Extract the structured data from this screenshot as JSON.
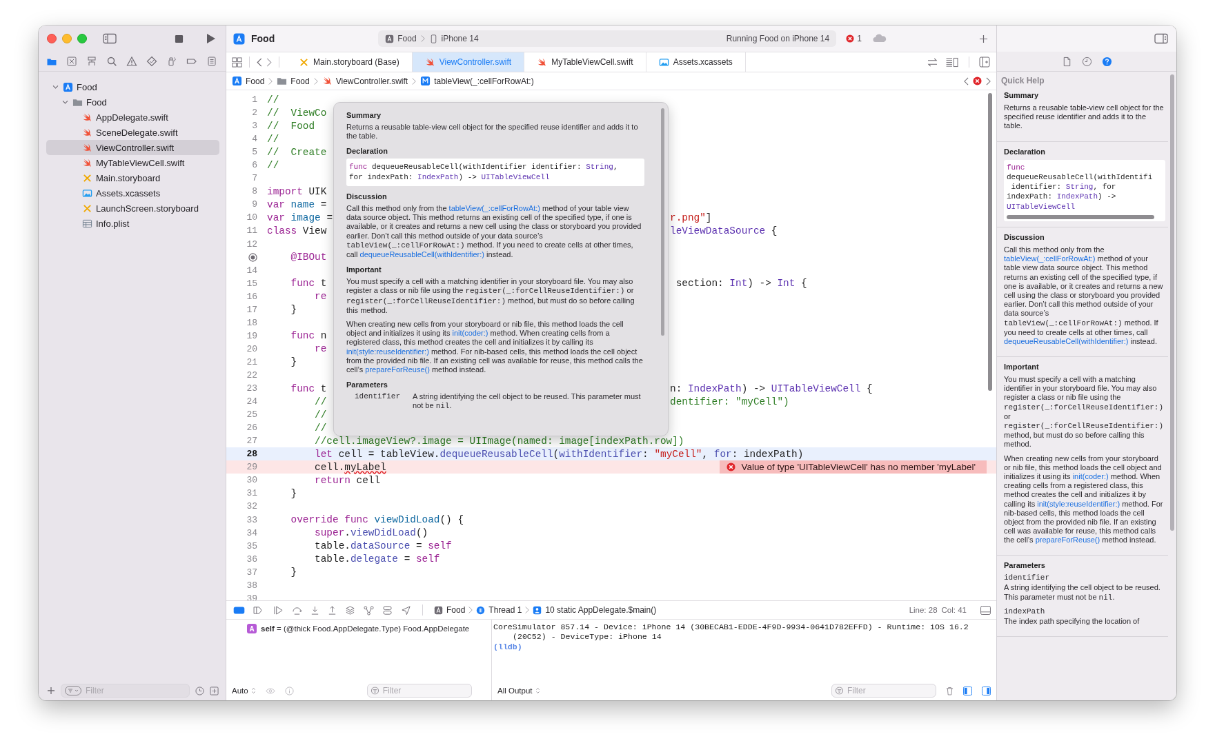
{
  "window": {
    "title": "Food"
  },
  "navigator_tabs": [
    {
      "kind": "folder",
      "selected": true
    },
    {
      "kind": "sourcecontrol",
      "selected": false
    },
    {
      "kind": "hierarchy",
      "selected": false
    },
    {
      "kind": "search",
      "selected": false
    },
    {
      "kind": "warning",
      "selected": false
    },
    {
      "kind": "test",
      "selected": false
    },
    {
      "kind": "debug",
      "selected": false
    },
    {
      "kind": "breakpoint",
      "selected": false
    },
    {
      "kind": "report",
      "selected": false
    }
  ],
  "tree": [
    {
      "label": "Food",
      "kind": "project",
      "expanded": true,
      "selected": false,
      "children": [
        {
          "label": "Food",
          "kind": "folder",
          "expanded": true,
          "selected": false,
          "children": [
            {
              "label": "AppDelegate.swift",
              "kind": "swift",
              "selected": false
            },
            {
              "label": "SceneDelegate.swift",
              "kind": "swift",
              "selected": false
            },
            {
              "label": "ViewController.swift",
              "kind": "swift",
              "selected": true
            },
            {
              "label": "MyTableViewCell.swift",
              "kind": "swift",
              "selected": false
            },
            {
              "label": "Main.storyboard",
              "kind": "storyboard",
              "selected": false
            },
            {
              "label": "Assets.xcassets",
              "kind": "assets",
              "selected": false
            },
            {
              "label": "LaunchScreen.storyboard",
              "kind": "storyboard",
              "selected": false
            },
            {
              "label": "Info.plist",
              "kind": "plist",
              "selected": false
            }
          ]
        }
      ]
    }
  ],
  "navigator_filter": {
    "placeholder": "Filter"
  },
  "activity": {
    "scheme": "Food",
    "device": "iPhone 14",
    "status": "Running Food on iPhone 14",
    "issues": "1"
  },
  "editor_tabs": [
    {
      "label": "Main.storyboard (Base)",
      "kind": "storyboard",
      "selected": false
    },
    {
      "label": "ViewController.swift",
      "kind": "swift",
      "selected": true
    },
    {
      "label": "MyTableViewCell.swift",
      "kind": "swift",
      "selected": false
    },
    {
      "label": "Assets.xcassets",
      "kind": "assets",
      "selected": false
    }
  ],
  "jump_bar": [
    {
      "label": "Food",
      "kind": "project"
    },
    {
      "label": "Food",
      "kind": "folder"
    },
    {
      "label": "ViewController.swift",
      "kind": "swift"
    },
    {
      "label": "tableView(_:cellForRowAt:)",
      "kind": "method"
    }
  ],
  "code_lines": [
    {
      "number": "1",
      "current": false,
      "error": false,
      "tokens": [
        {
          "kind": "cm",
          "text": "//"
        }
      ]
    },
    {
      "number": "2",
      "current": false,
      "error": false,
      "tokens": [
        {
          "kind": "cm",
          "text": "//  ViewCo"
        }
      ]
    },
    {
      "number": "3",
      "current": false,
      "error": false,
      "tokens": [
        {
          "kind": "cm",
          "text": "//  Food"
        }
      ]
    },
    {
      "number": "4",
      "current": false,
      "error": false,
      "tokens": [
        {
          "kind": "cm",
          "text": "//"
        }
      ]
    },
    {
      "number": "5",
      "current": false,
      "error": false,
      "tokens": [
        {
          "kind": "cm",
          "text": "//  Create"
        }
      ]
    },
    {
      "number": "6",
      "current": false,
      "error": false,
      "tokens": [
        {
          "kind": "cm",
          "text": "//"
        }
      ]
    },
    {
      "number": "7",
      "current": false,
      "error": false
    },
    {
      "number": "8",
      "current": false,
      "error": false,
      "tokens": [
        {
          "kind": "kw",
          "text": "import"
        },
        {
          "kind": "pl",
          "text": " UIK"
        }
      ]
    },
    {
      "number": "9",
      "current": false,
      "error": false,
      "tokens": [
        {
          "kind": "kw",
          "text": "var"
        },
        {
          "kind": "dc",
          "text": " name"
        },
        {
          "kind": "pl",
          "text": " ="
        }
      ]
    },
    {
      "number": "10",
      "current": false,
      "error": false,
      "tokens": [
        {
          "kind": "kw",
          "text": "var"
        },
        {
          "kind": "dc",
          "text": " image"
        },
        {
          "kind": "pl",
          "text": " ="
        }
      ],
      "right": [
        {
          "kind": "st",
          "text": "r.png\""
        },
        {
          "kind": "pl",
          "text": "]"
        }
      ]
    },
    {
      "number": "11",
      "current": false,
      "error": false,
      "tokens": [
        {
          "kind": "kw",
          "text": "class"
        },
        {
          "kind": "pl",
          "text": " View"
        }
      ],
      "right": [
        {
          "kind": "ty",
          "text": "leViewDataSource"
        },
        {
          "kind": "pl",
          "text": " {"
        }
      ]
    },
    {
      "number": "12",
      "current": false,
      "error": false
    },
    {
      "outlet_connected": true,
      "current": false,
      "error": false,
      "tokens": [
        {
          "kind": "kw",
          "text": "    @IBOut"
        }
      ]
    },
    {
      "number": "14",
      "current": false,
      "error": false
    },
    {
      "number": "15",
      "current": false,
      "error": false,
      "tokens": [
        {
          "kind": "kw",
          "text": "    func"
        },
        {
          "kind": "pl",
          "text": " t"
        }
      ],
      "right": [
        {
          "kind": "pl",
          "text": " section: "
        },
        {
          "kind": "ty",
          "text": "Int"
        },
        {
          "kind": "pl",
          "text": ") -> "
        },
        {
          "kind": "ty",
          "text": "Int"
        },
        {
          "kind": "pl",
          "text": " {"
        }
      ]
    },
    {
      "number": "16",
      "current": false,
      "error": false,
      "tokens": [
        {
          "kind": "kw",
          "text": "        re"
        }
      ]
    },
    {
      "number": "17",
      "current": false,
      "error": false,
      "tokens": [
        {
          "kind": "pl",
          "text": "    }"
        }
      ]
    },
    {
      "number": "18",
      "current": false,
      "error": false
    },
    {
      "number": "19",
      "current": false,
      "error": false,
      "tokens": [
        {
          "kind": "kw",
          "text": "    func"
        },
        {
          "kind": "pl",
          "text": " n"
        }
      ]
    },
    {
      "number": "20",
      "current": false,
      "error": false,
      "tokens": [
        {
          "kind": "kw",
          "text": "        re"
        }
      ]
    },
    {
      "number": "21",
      "current": false,
      "error": false,
      "tokens": [
        {
          "kind": "pl",
          "text": "    }"
        }
      ]
    },
    {
      "number": "22",
      "current": false,
      "error": false
    },
    {
      "number": "23",
      "current": false,
      "error": false,
      "tokens": [
        {
          "kind": "kw",
          "text": "    func"
        },
        {
          "kind": "pl",
          "text": " t"
        }
      ],
      "right": [
        {
          "kind": "pl",
          "text": "n: "
        },
        {
          "kind": "ty",
          "text": "IndexPath"
        },
        {
          "kind": "pl",
          "text": ") -> "
        },
        {
          "kind": "ty",
          "text": "UITableViewCell"
        },
        {
          "kind": "pl",
          "text": " {"
        }
      ]
    },
    {
      "number": "24",
      "current": false,
      "error": false,
      "tokens": [
        {
          "kind": "cm",
          "text": "        //"
        }
      ],
      "right": [
        {
          "kind": "cm",
          "text": "dentifier: \"myCell\")"
        }
      ]
    },
    {
      "number": "25",
      "current": false,
      "error": false,
      "tokens": [
        {
          "kind": "cm",
          "text": "        //"
        }
      ]
    },
    {
      "number": "26",
      "current": false,
      "error": false,
      "tokens": [
        {
          "kind": "cm",
          "text": "        //"
        }
      ]
    },
    {
      "number": "27",
      "current": false,
      "error": false,
      "tokens": [
        {
          "kind": "cm",
          "text": "        //cell.imageView?.image = UIImage(named: image[indexPath.row])"
        }
      ]
    },
    {
      "number": "28",
      "current": true,
      "error": false,
      "tokens": [
        {
          "kind": "kw",
          "text": "        let"
        },
        {
          "kind": "pl",
          "text": " cell = tableView."
        },
        {
          "kind": "fn",
          "text": "dequeueReusableCell"
        },
        {
          "kind": "pl",
          "text": "("
        },
        {
          "kind": "fn",
          "text": "withIdentifier"
        },
        {
          "kind": "pl",
          "text": ": "
        },
        {
          "kind": "st",
          "text": "\"myCell\""
        },
        {
          "kind": "pl",
          "text": ", "
        },
        {
          "kind": "fn",
          "text": "for"
        },
        {
          "kind": "pl",
          "text": ": indexPath)"
        }
      ]
    },
    {
      "number": "29",
      "current": false,
      "error": true,
      "tokens": [
        {
          "kind": "pl",
          "text": "        cell."
        },
        {
          "kind": "er",
          "text": "myLabel"
        }
      ],
      "error_message": "Value of type 'UITableViewCell' has no member 'myLabel'"
    },
    {
      "number": "30",
      "current": false,
      "error": false,
      "tokens": [
        {
          "kind": "kw",
          "text": "        return"
        },
        {
          "kind": "pl",
          "text": " cell"
        }
      ]
    },
    {
      "number": "31",
      "current": false,
      "error": false,
      "tokens": [
        {
          "kind": "pl",
          "text": "    }"
        }
      ]
    },
    {
      "number": "32",
      "current": false,
      "error": false
    },
    {
      "number": "33",
      "current": false,
      "error": false,
      "tokens": [
        {
          "kind": "kw",
          "text": "    override"
        },
        {
          "kind": "kw",
          "text": " func"
        },
        {
          "kind": "dc",
          "text": " viewDidLoad"
        },
        {
          "kind": "pl",
          "text": "() {"
        }
      ]
    },
    {
      "number": "34",
      "current": false,
      "error": false,
      "tokens": [
        {
          "kind": "kw",
          "text": "        super"
        },
        {
          "kind": "pl",
          "text": "."
        },
        {
          "kind": "fn",
          "text": "viewDidLoad"
        },
        {
          "kind": "pl",
          "text": "()"
        }
      ]
    },
    {
      "number": "35",
      "current": false,
      "error": false,
      "tokens": [
        {
          "kind": "pl",
          "text": "        table."
        },
        {
          "kind": "fn",
          "text": "dataSource"
        },
        {
          "kind": "pl",
          "text": " = "
        },
        {
          "kind": "kw",
          "text": "self"
        }
      ]
    },
    {
      "number": "36",
      "current": false,
      "error": false,
      "tokens": [
        {
          "kind": "pl",
          "text": "        table."
        },
        {
          "kind": "fn",
          "text": "delegate"
        },
        {
          "kind": "pl",
          "text": " = "
        },
        {
          "kind": "kw",
          "text": "self"
        }
      ]
    },
    {
      "number": "37",
      "current": false,
      "error": false,
      "tokens": [
        {
          "kind": "pl",
          "text": "    }"
        }
      ]
    },
    {
      "number": "38",
      "current": false,
      "error": false
    },
    {
      "number": "39",
      "current": false,
      "error": false
    }
  ],
  "popover": {
    "sections": [
      {
        "heading": "Summary",
        "blocks": [
          {
            "kind": "para",
            "parts": [
              {
                "kind": "text",
                "text": "Returns a reusable table-view cell object for the specified reuse identifier and adds it to the table."
              }
            ]
          }
        ]
      },
      {
        "heading": "Declaration",
        "blocks": [
          {
            "kind": "code",
            "lines": [
              {
                "tokens": [
                  {
                    "kind": "kw",
                    "text": "func"
                  },
                  {
                    "kind": "pl",
                    "text": " dequeueReusableCell(withIdentifier identifier: "
                  },
                  {
                    "kind": "ty",
                    "text": "String"
                  },
                  {
                    "kind": "pl",
                    "text": ","
                  }
                ]
              },
              {
                "tokens": [
                  {
                    "kind": "pl",
                    "text": "for indexPath: "
                  },
                  {
                    "kind": "ty",
                    "text": "IndexPath"
                  },
                  {
                    "kind": "pl",
                    "text": ") -> "
                  },
                  {
                    "kind": "ty",
                    "text": "UITableViewCell"
                  }
                ]
              }
            ]
          }
        ]
      },
      {
        "heading": "Discussion",
        "blocks": [
          {
            "kind": "para",
            "parts": [
              {
                "kind": "text",
                "text": "Call this method only from the "
              },
              {
                "kind": "link",
                "text": "tableView(_:cellForRowAt:)"
              },
              {
                "kind": "text",
                "text": " method of your table view data source object. This method returns an existing cell of the specified type, if one is available, or it creates and returns a new cell using the class or storyboard you provided earlier. Don’t call this method outside of your data source’s "
              },
              {
                "kind": "code",
                "text": "tableView(_:cellForRowAt:)"
              },
              {
                "kind": "text",
                "text": " method. If you need to create cells at other times, call "
              },
              {
                "kind": "link",
                "text": "dequeueReusableCell(withIdentifier:)"
              },
              {
                "kind": "text",
                "text": " instead."
              }
            ]
          }
        ]
      },
      {
        "heading": "Important",
        "blocks": [
          {
            "kind": "para",
            "parts": [
              {
                "kind": "text",
                "text": "You must specify a cell with a matching identifier in your storyboard file. You may also register a class or nib file using the "
              },
              {
                "kind": "code",
                "text": "register(_:forCellReuseIdentifier:)"
              },
              {
                "kind": "text",
                "text": " or "
              },
              {
                "kind": "code",
                "text": "register(_:forCellReuseIdentifier:)"
              },
              {
                "kind": "text",
                "text": " method, but must do so before calling this method."
              }
            ]
          },
          {
            "kind": "para",
            "parts": [
              {
                "kind": "text",
                "text": "When creating new cells from your storyboard or nib file, this method loads the cell object and initializes it using its "
              },
              {
                "kind": "link",
                "text": "init(coder:)"
              },
              {
                "kind": "text",
                "text": " method. When creating cells from a registered class, this method creates the cell and initializes it by calling its "
              },
              {
                "kind": "link",
                "text": "init(style:reuseIdentifier:)"
              },
              {
                "kind": "text",
                "text": " method. For nib-based cells, this method loads the cell object from the provided nib file. If an existing cell was available for reuse, this method calls the cell’s "
              },
              {
                "kind": "link",
                "text": "prepareForReuse()"
              },
              {
                "kind": "text",
                "text": " method instead."
              }
            ]
          }
        ]
      },
      {
        "heading": "Parameters",
        "blocks": [
          {
            "kind": "params",
            "items": [
              {
                "name": "identifier",
                "parts": [
                  {
                    "kind": "text",
                    "text": "A string identifying the cell object to be reused. This parameter must not be "
                  },
                  {
                    "kind": "code",
                    "text": "nil"
                  },
                  {
                    "kind": "text",
                    "text": "."
                  }
                ]
              }
            ]
          }
        ]
      }
    ]
  },
  "inspector_tabs": [
    {
      "kind": "file",
      "selected": false
    },
    {
      "kind": "history",
      "selected": false
    },
    {
      "kind": "help",
      "selected": true
    }
  ],
  "quick_help": {
    "title": "Quick Help",
    "sections": [
      {
        "heading": "Summary",
        "blocks": [
          {
            "kind": "para",
            "parts": [
              {
                "kind": "text",
                "text": "Returns a reusable table-view cell object for the specified reuse identifier and adds it to the table."
              }
            ]
          }
        ]
      },
      {
        "heading": "Declaration",
        "blocks": [
          {
            "kind": "code",
            "lines": [
              {
                "tokens": [
                  {
                    "kind": "kw",
                    "text": "func"
                  }
                ]
              },
              {
                "tokens": [
                  {
                    "kind": "pl",
                    "text": "dequeueReusableCell(withIdentifi"
                  }
                ]
              },
              {
                "tokens": [
                  {
                    "kind": "pl",
                    "text": " identifier: "
                  },
                  {
                    "kind": "ty",
                    "text": "String"
                  },
                  {
                    "kind": "pl",
                    "text": ", for"
                  }
                ]
              },
              {
                "tokens": [
                  {
                    "kind": "pl",
                    "text": "indexPath: "
                  },
                  {
                    "kind": "ty",
                    "text": "IndexPath"
                  },
                  {
                    "kind": "pl",
                    "text": ") ->"
                  }
                ]
              },
              {
                "tokens": [
                  {
                    "kind": "ty",
                    "text": "UITableViewCell"
                  }
                ]
              }
            ]
          }
        ]
      },
      {
        "heading": "Discussion",
        "blocks": [
          {
            "kind": "para",
            "parts": [
              {
                "kind": "text",
                "text": "Call this method only from the "
              },
              {
                "kind": "link",
                "text": "tableView(_:cellForRowAt:)"
              },
              {
                "kind": "text",
                "text": " method of your table view data source object. This method returns an existing cell of the specified type, if one is available, or it creates and returns a new cell using the class or storyboard you provided earlier. Don’t call this method outside of your data source’s "
              },
              {
                "kind": "code",
                "text": "tableView(_:cellForRowAt:)"
              },
              {
                "kind": "text",
                "text": " method. If you need to create cells at other times, call "
              },
              {
                "kind": "link",
                "text": "dequeueReusableCell(withIdentifier:)"
              },
              {
                "kind": "text",
                "text": " instead."
              }
            ]
          }
        ]
      },
      {
        "heading": "Important",
        "blocks": [
          {
            "kind": "para",
            "parts": [
              {
                "kind": "text",
                "text": "You must specify a cell with a matching identifier in your storyboard file. You may also register a class or nib file using the "
              },
              {
                "kind": "code",
                "text": "register(_:forCellReuseIdentifier:)"
              },
              {
                "kind": "text",
                "text": " or "
              },
              {
                "kind": "code",
                "text": "register(_:forCellReuseIdentifier:)"
              },
              {
                "kind": "text",
                "text": " method, but must do so before calling this method."
              }
            ]
          },
          {
            "kind": "para",
            "parts": [
              {
                "kind": "text",
                "text": "When creating new cells from your storyboard or nib file, this method loads the cell object and initializes it using its "
              },
              {
                "kind": "link",
                "text": "init(coder:)"
              },
              {
                "kind": "text",
                "text": " method. When creating cells from a registered class, this method creates the cell and initializes it by calling its "
              },
              {
                "kind": "link",
                "text": "init(style:reuseIdentifier:)"
              },
              {
                "kind": "text",
                "text": " method. For nib-based cells, this method loads the cell object from the provided nib file. If an existing cell was available for reuse, this method calls the cell’s "
              },
              {
                "kind": "link",
                "text": "prepareForReuse()"
              },
              {
                "kind": "text",
                "text": " method instead."
              }
            ]
          }
        ]
      },
      {
        "heading": "Parameters",
        "blocks": [
          {
            "kind": "params",
            "items": [
              {
                "name": "identifier",
                "parts": [
                  {
                    "kind": "text",
                    "text": "A string identifying the cell object to be reused. This parameter must not be "
                  },
                  {
                    "kind": "code",
                    "text": "nil"
                  },
                  {
                    "kind": "text",
                    "text": "."
                  }
                ]
              },
              {
                "name": "indexPath",
                "parts": [
                  {
                    "kind": "text",
                    "text": "The index path specifying the location of"
                  }
                ]
              }
            ]
          }
        ]
      }
    ]
  },
  "debug_bar": {
    "breadcrumb": [
      {
        "kind": "app",
        "label": "Food"
      },
      {
        "kind": "thread",
        "label": "Thread 1"
      },
      {
        "kind": "frame",
        "label": "10 static AppDelegate.$main()"
      }
    ],
    "line": "Line: 28",
    "column": "Col: 41"
  },
  "variables": [
    {
      "badge": "A",
      "text": "**self** = (@thick Food.AppDelegate.Type) Food.AppDelegate"
    }
  ],
  "variables_bar": {
    "scope": "Auto",
    "filter": {
      "placeholder": "Filter"
    }
  },
  "console": [
    {
      "kind": "output",
      "text": "CoreSimulator 857.14 - Device: iPhone 14 (30BECAB1-EDDE-4F9D-9934-0641D782EFFD) - Runtime: iOS 16.2 (20C52) - DeviceType: iPhone 14"
    },
    {
      "kind": "prompt",
      "text": "(lldb)"
    }
  ],
  "console_bar": {
    "scope": "All Output",
    "filter": {
      "placeholder": "Filter"
    }
  }
}
